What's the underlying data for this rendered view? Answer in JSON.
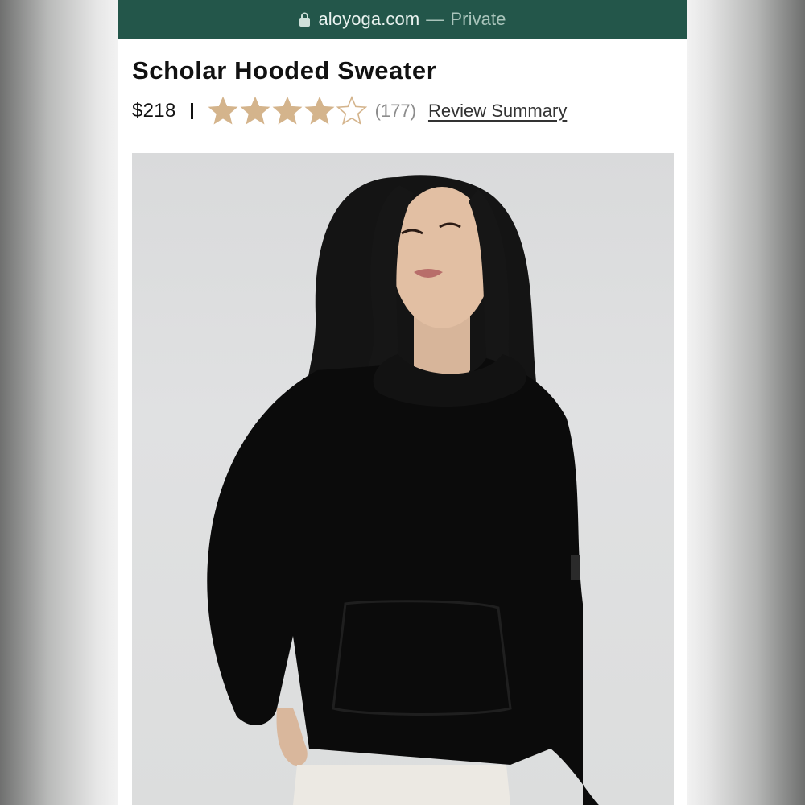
{
  "browser": {
    "domain": "aloyoga.com",
    "separator": "—",
    "mode": "Private",
    "lock_icon": "lock-icon"
  },
  "product": {
    "title": "Scholar Hooded Sweater",
    "price": "$218",
    "rating": 4,
    "rating_max": 5,
    "review_count": "(177)",
    "review_summary_label": "Review Summary",
    "image_alt": "Model wearing black hooded sweater"
  },
  "colors": {
    "header_bg": "#23564a",
    "star_fill": "#d4b48c",
    "text": "#111111"
  }
}
